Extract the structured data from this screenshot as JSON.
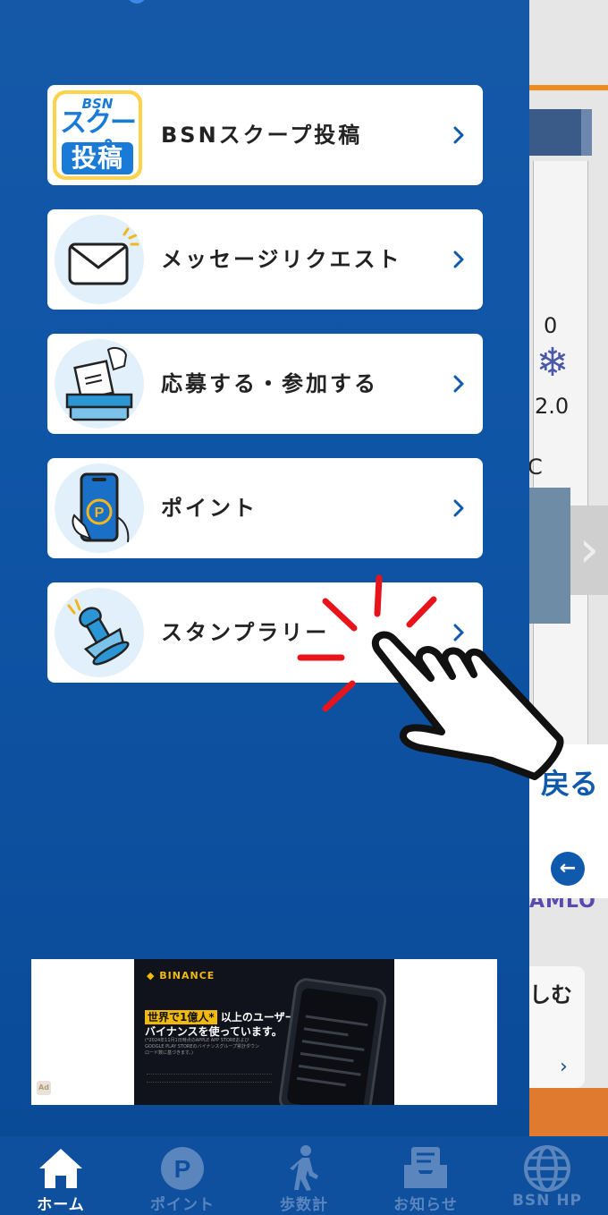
{
  "menu": {
    "items": [
      {
        "label": "BSNスクープ投稿",
        "logo_small": "BSN",
        "logo_line1": "スクープ",
        "logo_line2": "投稿"
      },
      {
        "label": "メッセージリクエスト",
        "icon": "envelope-icon"
      },
      {
        "label": "応募する・参加する",
        "icon": "ballot-box-icon"
      },
      {
        "label": "ポイント",
        "icon": "point-phone-icon"
      },
      {
        "label": "スタンプラリー",
        "icon": "stamp-icon"
      }
    ]
  },
  "back_tab": {
    "label": "戻る",
    "arrow": "←"
  },
  "background": {
    "value_zero": "0",
    "value_temp": "2.0",
    "value_c": "C",
    "snow_glyph": "❄",
    "logo_fragment": "AMLO",
    "card_text": "しむ"
  },
  "ad": {
    "brand": "◆ BINANCE",
    "headline_hl": "世界で1億人*",
    "headline_rest": " 以上のユーザーが",
    "headline2": "バイナンスを使っています。",
    "note": "(*2024年11月1日時点のAPPLE APP STOREおよびGOOGLE PLAY STOREのバイナンスグループ累計ダウンロード数に基づきます。)",
    "badge": "Ad"
  },
  "nav": {
    "items": [
      {
        "label": "ホーム",
        "icon": "home-icon",
        "active": true
      },
      {
        "label": "ポイント",
        "icon": "point-icon",
        "active": false
      },
      {
        "label": "歩数計",
        "icon": "walker-icon",
        "active": false
      },
      {
        "label": "お知らせ",
        "icon": "inbox-icon",
        "active": false
      },
      {
        "label": "BSN HP",
        "icon": "globe-icon",
        "active": false
      }
    ]
  },
  "colors": {
    "drawer": "#0f55a6",
    "nav_bg": "#0e4f9e",
    "accent": "#0f5aac",
    "tap_red": "#e8141c"
  }
}
